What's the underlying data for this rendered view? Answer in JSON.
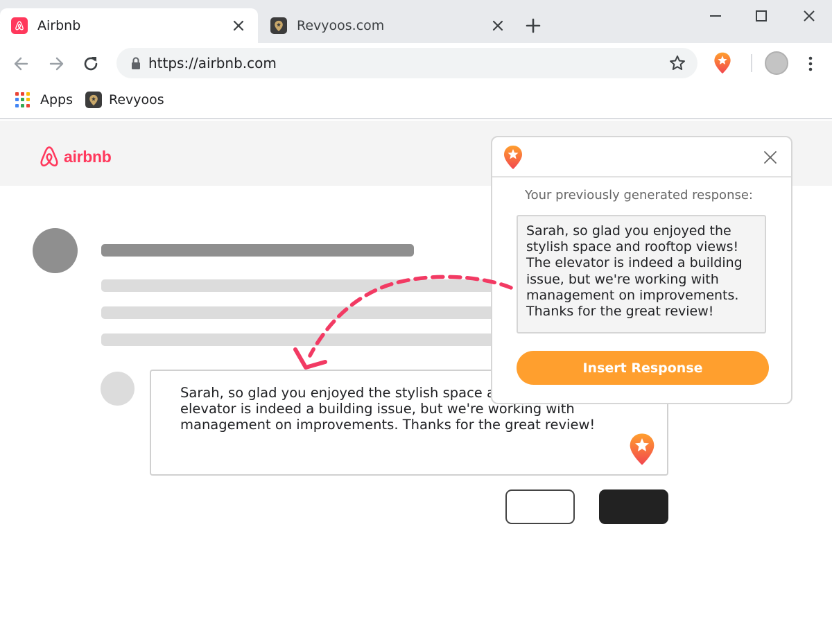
{
  "browser": {
    "tabs": [
      {
        "title": "Airbnb",
        "favicon": "airbnb-icon",
        "active": true
      },
      {
        "title": "Revyoos.com",
        "favicon": "revyoos-icon",
        "active": false
      }
    ],
    "address_bar": {
      "url": "https://airbnb.com"
    },
    "bookmarks": [
      {
        "label": "Apps",
        "icon": "apps-grid-icon"
      },
      {
        "label": "Revyoos",
        "icon": "revyoos-icon"
      }
    ]
  },
  "page": {
    "brand": {
      "name": "airbnb"
    },
    "reply_box": {
      "text": "Sarah, so glad you enjoyed the stylish space and rooftop views! The elevator is indeed a building issue, but we're working with management on improvements. Thanks for the great review!"
    }
  },
  "popup": {
    "label": "Your previously generated response:",
    "response": "Sarah, so glad you enjoyed the stylish space and rooftop views! The elevator is indeed a building issue, but we're working with management on improvements. Thanks for the great review!",
    "insert_button": "Insert Response"
  },
  "colors": {
    "airbnb_brand": "#ff385c",
    "revyoos_orange": "#ff9f2e",
    "revyoos_red": "#f2464f",
    "arrow": "#f23a63"
  }
}
